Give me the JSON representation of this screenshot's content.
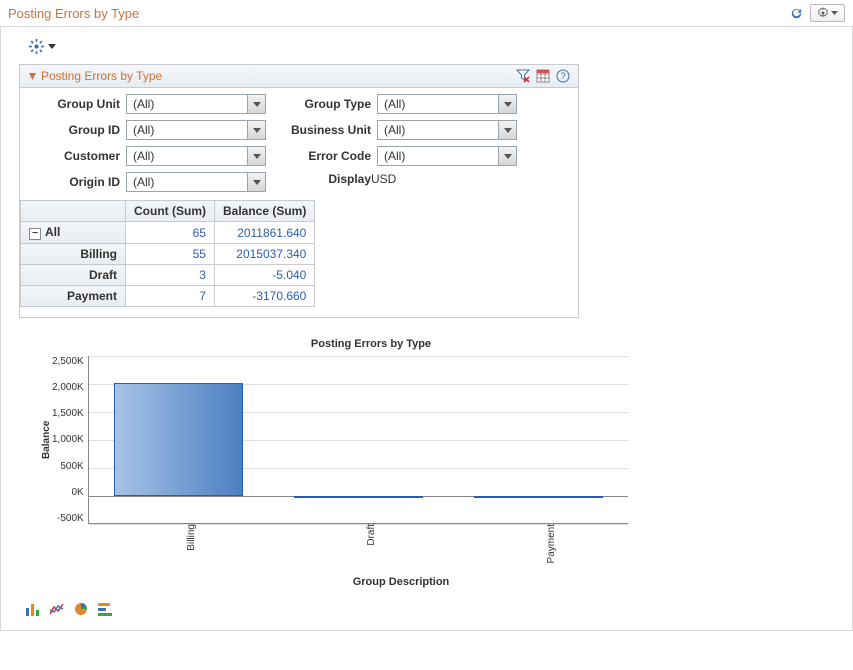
{
  "header": {
    "title": "Posting Errors by Type"
  },
  "panel": {
    "title": "Posting Errors by Type",
    "filters": {
      "left": [
        {
          "label": "Group Unit",
          "value": "(All)"
        },
        {
          "label": "Group ID",
          "value": "(All)"
        },
        {
          "label": "Customer",
          "value": "(All)"
        },
        {
          "label": "Origin ID",
          "value": "(All)"
        }
      ],
      "right": [
        {
          "label": "Group Type",
          "value": "(All)"
        },
        {
          "label": "Business Unit",
          "value": "(All)"
        },
        {
          "label": "Error Code",
          "value": "(All)"
        }
      ],
      "display": {
        "label": "Display",
        "value": "USD"
      }
    },
    "table": {
      "headers": [
        "",
        "Count (Sum)",
        "Balance (Sum)"
      ],
      "rows": [
        {
          "label": "All",
          "expandable": true,
          "count": "65",
          "balance": "2011861.640"
        },
        {
          "label": "Billing",
          "expandable": false,
          "count": "55",
          "balance": "2015037.340"
        },
        {
          "label": "Draft",
          "expandable": false,
          "count": "3",
          "balance": "-5.040"
        },
        {
          "label": "Payment",
          "expandable": false,
          "count": "7",
          "balance": "-3170.660"
        }
      ]
    }
  },
  "chart_data": {
    "type": "bar",
    "title": "Posting Errors by Type",
    "xlabel": "Group Description",
    "ylabel": "Balance",
    "categories": [
      "Billing",
      "Draft",
      "Payment"
    ],
    "values": [
      2015037.34,
      -5.04,
      -3170.66
    ],
    "y_ticks": [
      "2,500K",
      "2,000K",
      "1,500K",
      "1,000K",
      "500K",
      "0K",
      "-500K"
    ],
    "ylim": [
      -500000,
      2500000
    ]
  }
}
